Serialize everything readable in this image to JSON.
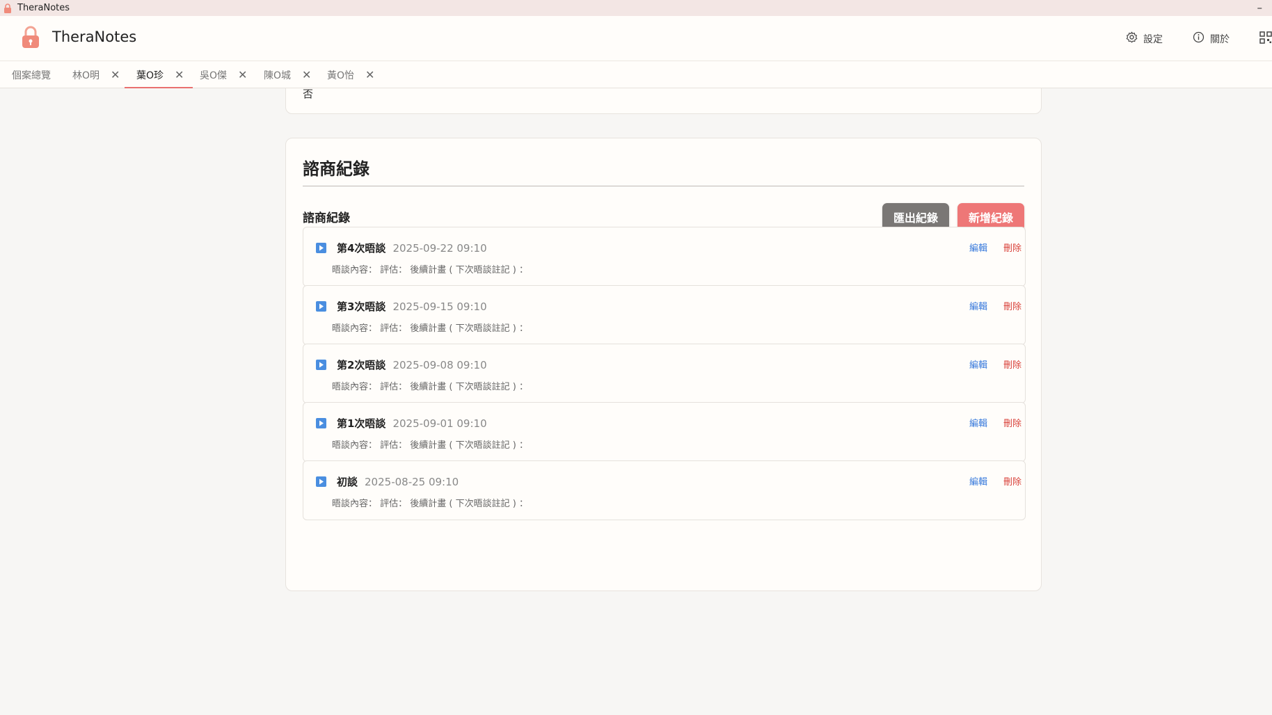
{
  "window": {
    "title": "TheraNotes",
    "minimize_glyph": "–"
  },
  "header": {
    "app_name": "TheraNotes",
    "settings_label": "設定",
    "about_label": "關於"
  },
  "tabs": [
    {
      "label": "個案總覽",
      "closable": false
    },
    {
      "label": "林O明",
      "closable": true
    },
    {
      "label": "葉O珍",
      "closable": true,
      "active": true
    },
    {
      "label": "吳O傑",
      "closable": true
    },
    {
      "label": "陳O城",
      "closable": true
    },
    {
      "label": "黃O怡",
      "closable": true
    }
  ],
  "tab_close_glyph": "✕",
  "previous_card": {
    "partial_text": "否"
  },
  "card": {
    "title": "諮商紀錄",
    "section_title": "諮商紀錄",
    "export_label": "匯出紀錄",
    "add_label": "新增紀錄"
  },
  "records": [
    {
      "title": "第4次晤談",
      "date": "2025-09-22  09:10",
      "summary": "晤談內容： 評估： 後續計畫 ( 下次晤談註記 ) ：",
      "edit": "編輯",
      "delete": "刪除"
    },
    {
      "title": "第3次晤談",
      "date": "2025-09-15  09:10",
      "summary": "晤談內容： 評估： 後續計畫 ( 下次晤談註記 ) ：",
      "edit": "編輯",
      "delete": "刪除"
    },
    {
      "title": "第2次晤談",
      "date": "2025-09-08  09:10",
      "summary": "晤談內容： 評估： 後續計畫 ( 下次晤談註記 ) ：",
      "edit": "編輯",
      "delete": "刪除"
    },
    {
      "title": "第1次晤談",
      "date": "2025-09-01  09:10",
      "summary": "晤談內容： 評估： 後續計畫 ( 下次晤談註記 ) ：",
      "edit": "編輯",
      "delete": "刪除"
    },
    {
      "title": "初談",
      "date": "2025-08-25  09:10",
      "summary": "晤談內容： 評估： 後續計畫 ( 下次晤談註記 ) ：",
      "edit": "編輯",
      "delete": "刪除"
    }
  ],
  "colors": {
    "accent": "#ee7777",
    "export_button": "#7a7775",
    "edit_link": "#3a7bdc",
    "delete_link": "#d9433b",
    "play_icon": "#4a8ee0"
  }
}
